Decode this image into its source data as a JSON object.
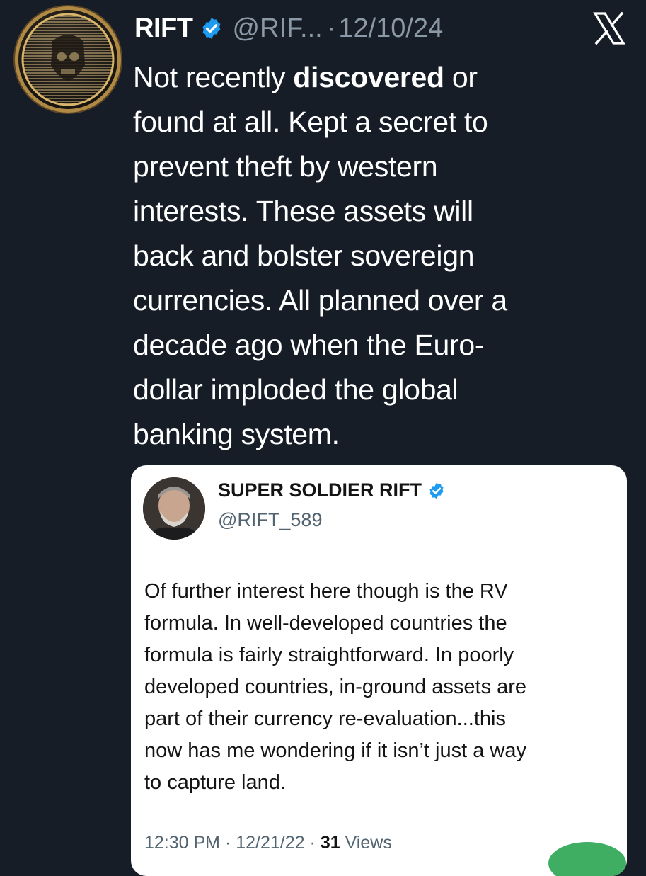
{
  "post": {
    "author_name": "RIFT",
    "handle": "@RIF...",
    "separator": "·",
    "date": "12/10/24",
    "icons": {
      "verified": "verified-badge-icon",
      "platform": "x-logo-icon"
    },
    "colors": {
      "background": "#161d27",
      "text": "#ffffff",
      "muted": "#8b98a5",
      "verified": "#1d9bf0"
    },
    "body_lines": [
      {
        "pre": "Not recently ",
        "bold": "discovered",
        "post": " or"
      },
      {
        "pre": "found at all.  Kept a secret to"
      },
      {
        "pre": "prevent theft by western"
      },
      {
        "pre": "interests.  These assets will"
      },
      {
        "pre": "back and bolster sovereign"
      },
      {
        "pre": "currencies.  All planned over a"
      },
      {
        "pre": "decade ago when the Euro-"
      },
      {
        "pre": "dollar imploded the global"
      },
      {
        "pre": "banking system."
      }
    ]
  },
  "quote": {
    "author_name": "SUPER SOLDIER RIFT",
    "handle": "@RIFT_589",
    "text_lines": [
      "Of further interest here though is the RV",
      "formula.  In well-developed countries the",
      "formula is fairly straightforward.  In poorly",
      "developed countries, in-ground assets are",
      "part of their currency re-evaluation...this",
      "now has me wondering if it isn’t just a way",
      "to capture land."
    ],
    "time": "12:30 PM",
    "date": "12/21/22",
    "views_count": "31",
    "views_label": "Views",
    "separator": "·"
  }
}
